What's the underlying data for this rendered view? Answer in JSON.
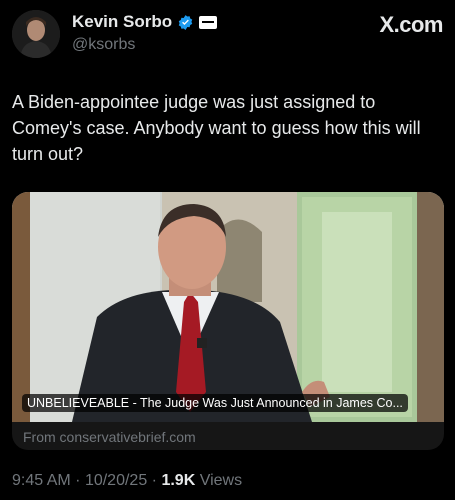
{
  "author": {
    "display_name": "Kevin Sorbo",
    "handle": "@ksorbs",
    "verified_icon": "verified-badge-icon",
    "affiliate_icon": "affiliate-badge-icon"
  },
  "brand": {
    "label": "X.com"
  },
  "tweet": {
    "text": "A Biden-appointee judge was just assigned to Comey's case. Anybody want to guess how this will turn out?"
  },
  "link_card": {
    "caption": "UNBELIEVEABLE - The Judge Was Just Announced in James Co...",
    "source": "From conservativebrief.com"
  },
  "meta": {
    "time": "9:45 AM",
    "sep1": "·",
    "date": "10/20/25",
    "sep2": "·",
    "views_count": "1.9K",
    "views_label": "Views"
  },
  "colors": {
    "background": "#000000",
    "text": "#e7e9ea",
    "secondary": "#71767b",
    "verified": "#1d9bf0"
  }
}
